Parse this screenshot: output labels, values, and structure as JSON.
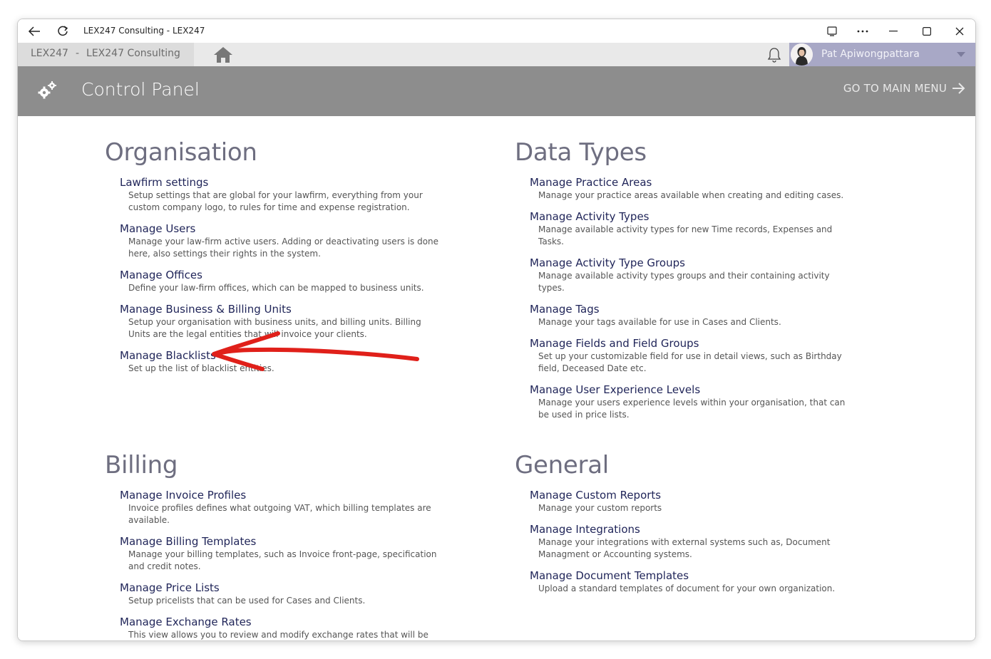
{
  "window": {
    "title": "LEX247 Consulting - LEX247",
    "icons": [
      "back-arrow-icon",
      "refresh-icon",
      "cast-icon",
      "more-icon",
      "minimize-icon",
      "maximize-icon",
      "close-icon"
    ]
  },
  "appbar": {
    "crumb_app": "LEX247",
    "crumb_sep": "-",
    "crumb_company": "LEX247 Consulting",
    "user_name": "Pat Apiwongpattara"
  },
  "header": {
    "title": "Control Panel",
    "goto_label": "GO TO MAIN MENU"
  },
  "sections": {
    "organisation": {
      "title": "Organisation",
      "items": [
        {
          "label": "Lawfirm settings",
          "desc": "Setup settings that are global for your lawfirm, everything from your custom company logo, to rules for time and expense registration."
        },
        {
          "label": "Manage Users",
          "desc": "Manage your law-firm active users. Adding or deactivating users is done here, also settings their rights in the system."
        },
        {
          "label": "Manage Offices",
          "desc": "Define your law-firm offices, which can be mapped to business units."
        },
        {
          "label": "Manage Business & Billing Units",
          "desc": "Setup your organisation with business units, and billing units. Billing Units are the legal entities that will invoice your clients."
        },
        {
          "label": "Manage Blacklists",
          "desc": "Set up the list of blacklist entities."
        }
      ]
    },
    "data_types": {
      "title": "Data Types",
      "items": [
        {
          "label": "Manage Practice Areas",
          "desc": "Manage your practice areas available when creating and editing cases."
        },
        {
          "label": "Manage Activity Types",
          "desc": "Manage available activity types for new Time records, Expenses and Tasks."
        },
        {
          "label": "Manage Activity Type Groups",
          "desc": "Manage available activity types groups and their containing activity types."
        },
        {
          "label": "Manage Tags",
          "desc": "Manage your tags available for use in Cases and Clients."
        },
        {
          "label": "Manage Fields and Field Groups",
          "desc": "Set up your customizable field for use in detail views, such as Birthday field, Deceased Date etc."
        },
        {
          "label": "Manage User Experience Levels",
          "desc": "Manage your users experience levels within your organisation, that can be used in price lists."
        }
      ]
    },
    "billing": {
      "title": "Billing",
      "items": [
        {
          "label": "Manage Invoice Profiles",
          "desc": "Invoice profiles defines what outgoing VAT, which billing templates are available."
        },
        {
          "label": "Manage Billing Templates",
          "desc": "Manage your billing templates, such as Invoice front-page, specification and credit notes."
        },
        {
          "label": "Manage Price Lists",
          "desc": "Setup pricelists that can be used for Cases and Clients."
        },
        {
          "label": "Manage Exchange Rates",
          "desc": "This view allows you to review and modify exchange rates that will be"
        }
      ]
    },
    "general": {
      "title": "General",
      "items": [
        {
          "label": "Manage Custom Reports",
          "desc": "Manage your custom reports"
        },
        {
          "label": "Manage Integrations",
          "desc": "Manage your integrations with external systems such as, Document Managment or Accounting systems."
        },
        {
          "label": "Manage Document Templates",
          "desc": "Upload a standard templates of document for your own organization."
        }
      ]
    }
  },
  "colors": {
    "header_bg": "#8d8d8d",
    "user_bg": "#a8a8c6",
    "link": "#1f2458",
    "section_title": "#6e6e80",
    "annotation_arrow": "#e0201a"
  }
}
